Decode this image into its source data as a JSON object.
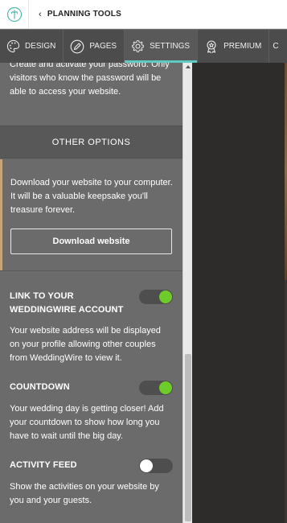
{
  "topbar": {
    "back_label": "PLANNING TOOLS"
  },
  "tabs": [
    {
      "label": "DESIGN",
      "icon": "palette-icon"
    },
    {
      "label": "PAGES",
      "icon": "pencil-icon"
    },
    {
      "label": "SETTINGS",
      "icon": "gear-icon",
      "active": true
    },
    {
      "label": "PREMIUM",
      "icon": "award-icon"
    },
    {
      "label": "C"
    }
  ],
  "password": {
    "text": "Create and activate your password. Only visitors who know the password will be able to access your website."
  },
  "other_options": {
    "header": "OTHER OPTIONS",
    "download_text": "Download your website to your computer. It will be a valuable keepsake you'll treasure forever.",
    "download_button": "Download website"
  },
  "options": [
    {
      "title": "LINK TO YOUR WEDDINGWIRE ACCOUNT",
      "desc": "Your website address will be displayed on your profile allowing other couples from WeddingWire to view it.",
      "enabled": true
    },
    {
      "title": "COUNTDOWN",
      "desc": "Your wedding day is getting closer! Add your countdown to show how long you have to wait until the big day.",
      "enabled": true
    },
    {
      "title": "ACTIVITY FEED",
      "desc": "Show the activities on your website by you and your guests.",
      "enabled": false
    }
  ],
  "colors": {
    "accent_tab": "#5fc9c2",
    "toggle_on": "#6fcb2a",
    "download_border": "#c9a37a"
  }
}
